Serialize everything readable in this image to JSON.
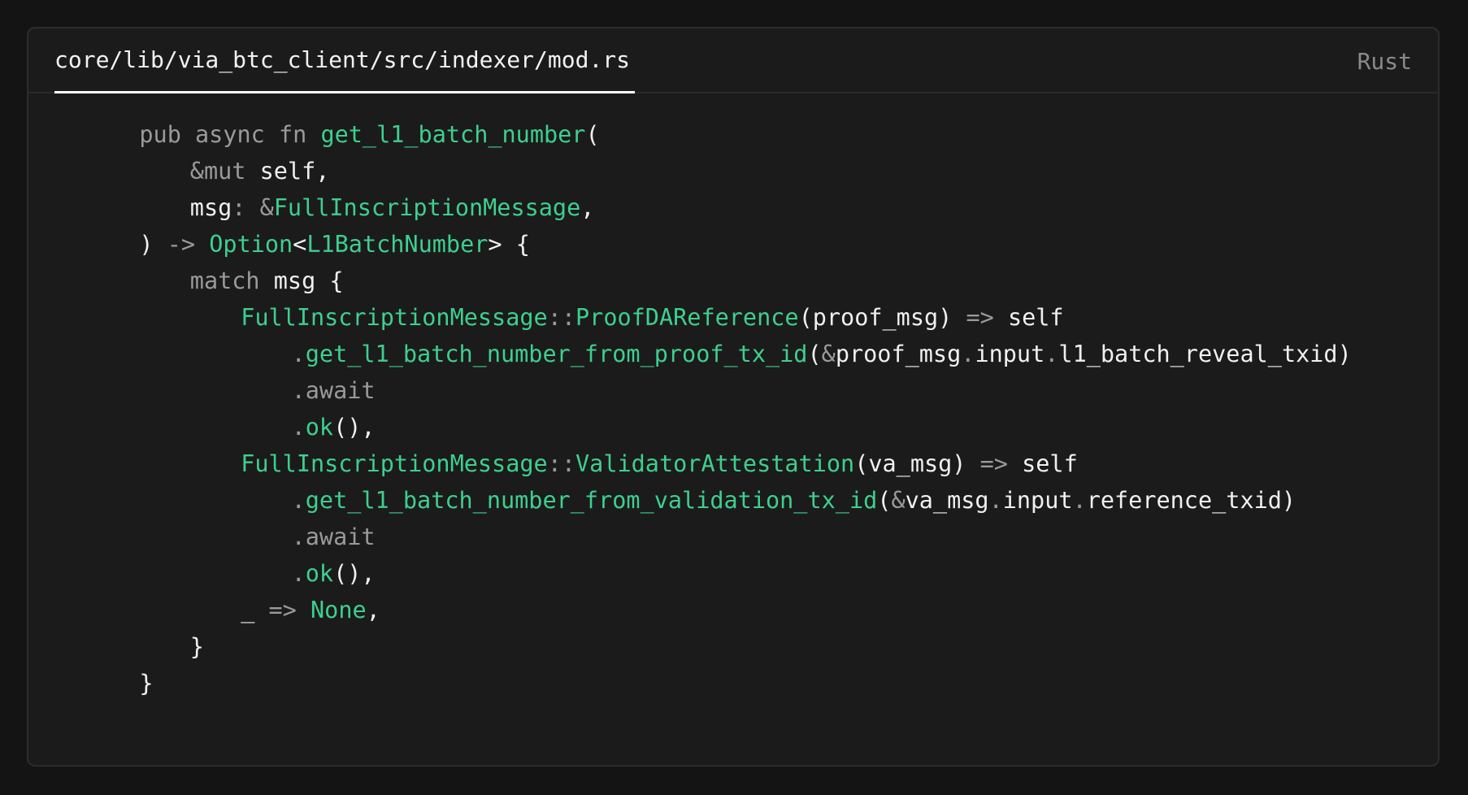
{
  "file_tab": "core/lib/via_btc_client/src/indexer/mod.rs",
  "language": "Rust",
  "code": {
    "lines": [
      {
        "indent": 4,
        "tokens": [
          {
            "t": "pub async fn ",
            "k": "kw"
          },
          {
            "t": "get_l1_batch_number",
            "k": "fn"
          },
          {
            "t": "(",
            "k": "id"
          }
        ]
      },
      {
        "indent": 8,
        "tokens": [
          {
            "t": "&mut ",
            "k": "kw"
          },
          {
            "t": "self,",
            "k": "id"
          }
        ]
      },
      {
        "indent": 8,
        "tokens": [
          {
            "t": "msg",
            "k": "id"
          },
          {
            "t": ": &",
            "k": "punc"
          },
          {
            "t": "FullInscriptionMessage",
            "k": "ty"
          },
          {
            "t": ",",
            "k": "id"
          }
        ]
      },
      {
        "indent": 4,
        "tokens": [
          {
            "t": ") ",
            "k": "id"
          },
          {
            "t": "-> ",
            "k": "punc"
          },
          {
            "t": "Option",
            "k": "ty"
          },
          {
            "t": "<",
            "k": "id"
          },
          {
            "t": "L1BatchNumber",
            "k": "ty"
          },
          {
            "t": "> {",
            "k": "id"
          }
        ]
      },
      {
        "indent": 8,
        "tokens": [
          {
            "t": "match ",
            "k": "kw"
          },
          {
            "t": "msg {",
            "k": "id"
          }
        ]
      },
      {
        "indent": 12,
        "tokens": [
          {
            "t": "FullInscriptionMessage",
            "k": "ty"
          },
          {
            "t": "::",
            "k": "punc"
          },
          {
            "t": "ProofDAReference",
            "k": "ty"
          },
          {
            "t": "(proof_msg) ",
            "k": "id"
          },
          {
            "t": "=> ",
            "k": "punc"
          },
          {
            "t": "self",
            "k": "id"
          }
        ]
      },
      {
        "indent": 16,
        "tokens": [
          {
            "t": ".",
            "k": "punc"
          },
          {
            "t": "get_l1_batch_number_from_proof_tx_id",
            "k": "fn"
          },
          {
            "t": "(",
            "k": "id"
          },
          {
            "t": "&",
            "k": "punc"
          },
          {
            "t": "proof_msg",
            "k": "id"
          },
          {
            "t": ".",
            "k": "punc"
          },
          {
            "t": "input",
            "k": "id"
          },
          {
            "t": ".",
            "k": "punc"
          },
          {
            "t": "l1_batch_reveal_txid)",
            "k": "id"
          }
        ]
      },
      {
        "indent": 16,
        "tokens": [
          {
            "t": ".await",
            "k": "kw"
          }
        ]
      },
      {
        "indent": 16,
        "tokens": [
          {
            "t": ".",
            "k": "punc"
          },
          {
            "t": "ok",
            "k": "fn"
          },
          {
            "t": "(),",
            "k": "id"
          }
        ]
      },
      {
        "indent": 12,
        "tokens": [
          {
            "t": "FullInscriptionMessage",
            "k": "ty"
          },
          {
            "t": "::",
            "k": "punc"
          },
          {
            "t": "ValidatorAttestation",
            "k": "ty"
          },
          {
            "t": "(va_msg) ",
            "k": "id"
          },
          {
            "t": "=> ",
            "k": "punc"
          },
          {
            "t": "self",
            "k": "id"
          }
        ]
      },
      {
        "indent": 16,
        "tokens": [
          {
            "t": ".",
            "k": "punc"
          },
          {
            "t": "get_l1_batch_number_from_validation_tx_id",
            "k": "fn"
          },
          {
            "t": "(",
            "k": "id"
          },
          {
            "t": "&",
            "k": "punc"
          },
          {
            "t": "va_msg",
            "k": "id"
          },
          {
            "t": ".",
            "k": "punc"
          },
          {
            "t": "input",
            "k": "id"
          },
          {
            "t": ".",
            "k": "punc"
          },
          {
            "t": "reference_txid)",
            "k": "id"
          }
        ]
      },
      {
        "indent": 16,
        "tokens": [
          {
            "t": ".await",
            "k": "kw"
          }
        ]
      },
      {
        "indent": 16,
        "tokens": [
          {
            "t": ".",
            "k": "punc"
          },
          {
            "t": "ok",
            "k": "fn"
          },
          {
            "t": "(),",
            "k": "id"
          }
        ]
      },
      {
        "indent": 12,
        "tokens": [
          {
            "t": "_ ",
            "k": "id"
          },
          {
            "t": "=> ",
            "k": "punc"
          },
          {
            "t": "None",
            "k": "ty"
          },
          {
            "t": ",",
            "k": "id"
          }
        ]
      },
      {
        "indent": 8,
        "tokens": [
          {
            "t": "}",
            "k": "id"
          }
        ]
      },
      {
        "indent": 4,
        "tokens": [
          {
            "t": "}",
            "k": "id"
          }
        ]
      }
    ]
  }
}
